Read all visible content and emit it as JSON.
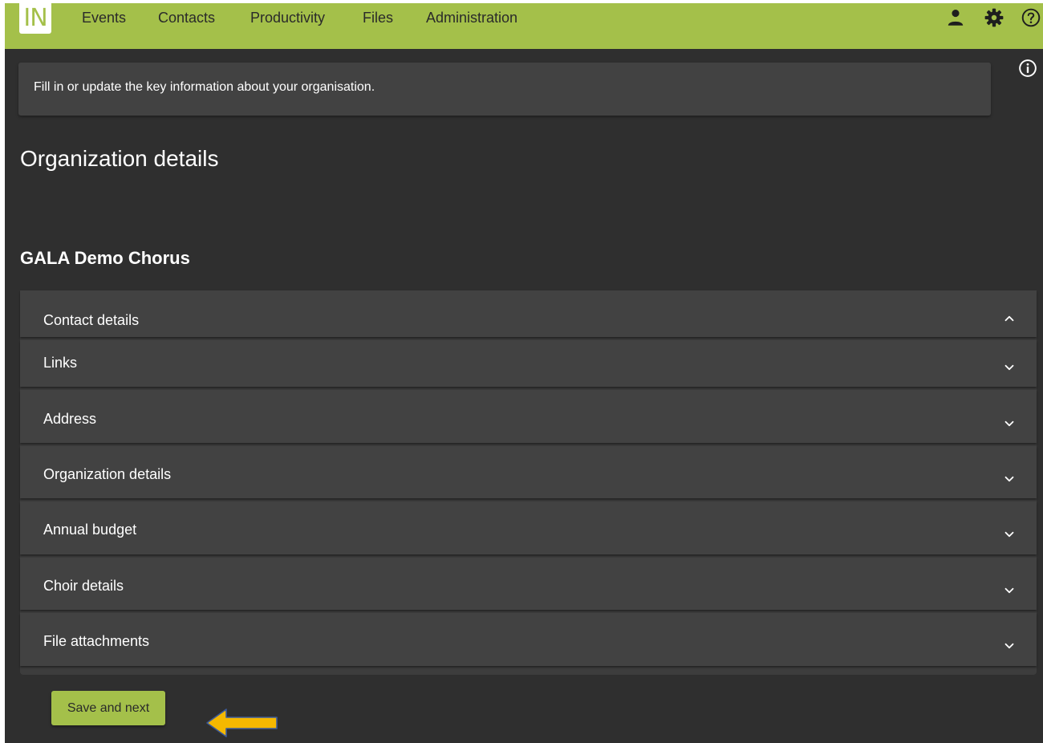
{
  "header": {
    "logo_text": "IN",
    "nav": [
      {
        "label": "Events"
      },
      {
        "label": "Contacts"
      },
      {
        "label": "Productivity"
      },
      {
        "label": "Files"
      },
      {
        "label": "Administration"
      }
    ],
    "icons": [
      "person-icon",
      "settings-gear-icon",
      "help-circle-icon"
    ],
    "accent_color": "#a4c04a"
  },
  "banner": {
    "text": "Fill in or update the key information about your organisation.",
    "icon": "info-circle-icon"
  },
  "page": {
    "title": "Organization details",
    "org_name": "GALA Demo Chorus"
  },
  "accordion": {
    "sections": [
      {
        "label": "Contact details",
        "expanded": true
      },
      {
        "label": "Links",
        "expanded": false
      },
      {
        "label": "Address",
        "expanded": false
      },
      {
        "label": "Organization details",
        "expanded": false
      },
      {
        "label": "Annual budget",
        "expanded": false
      },
      {
        "label": "Choir details",
        "expanded": false
      },
      {
        "label": "File attachments",
        "expanded": false
      }
    ]
  },
  "footer": {
    "save_label": "Save and next",
    "annotation_arrow_color": "#f5b800"
  }
}
